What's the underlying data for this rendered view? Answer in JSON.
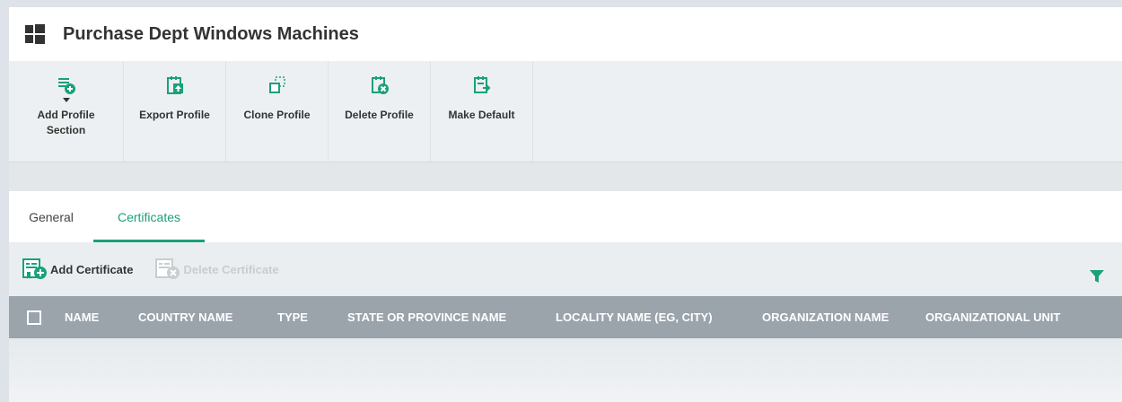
{
  "header": {
    "title": "Purchase Dept Windows Machines",
    "icon": "windows-logo-icon"
  },
  "toolbar": {
    "buttons": [
      {
        "label": "Add Profile Section",
        "icon": "add-section-icon"
      },
      {
        "label": "Export Profile",
        "icon": "export-icon"
      },
      {
        "label": "Clone Profile",
        "icon": "clone-icon"
      },
      {
        "label": "Delete Profile",
        "icon": "delete-profile-icon"
      },
      {
        "label": "Make Default",
        "icon": "make-default-icon"
      }
    ]
  },
  "tabs": [
    {
      "label": "General",
      "active": false
    },
    {
      "label": "Certificates",
      "active": true
    }
  ],
  "actions": {
    "add_label": "Add Certificate",
    "delete_label": "Delete Certificate",
    "filter_icon": "filter-icon"
  },
  "table": {
    "columns": [
      "NAME",
      "COUNTRY NAME",
      "TYPE",
      "STATE OR PROVINCE NAME",
      "LOCALITY NAME (EG, CITY)",
      "ORGANIZATION NAME",
      "ORGANIZATIONAL UNIT"
    ],
    "rows": []
  },
  "colors": {
    "accent": "#1aa17a",
    "header_bg": "#9ba3ab",
    "disabled": "#c8cdd1"
  }
}
